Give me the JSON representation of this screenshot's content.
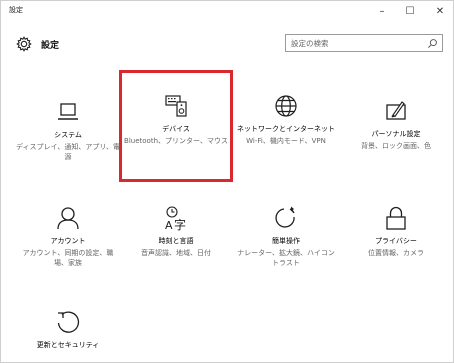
{
  "window": {
    "title": "設定",
    "controls": {
      "minimize": "–",
      "maximize": "☐",
      "close": "✕"
    }
  },
  "header": {
    "title": "設定",
    "search_placeholder": "設定の検索"
  },
  "tiles": [
    {
      "label": "システム",
      "desc": "ディスプレイ、通知、アプリ、電源"
    },
    {
      "label": "デバイス",
      "desc": "Bluetooth、プリンター、マウス"
    },
    {
      "label": "ネットワークとインターネット",
      "desc": "Wi-Fi、機内モード、VPN"
    },
    {
      "label": "パーソナル設定",
      "desc": "背景、ロック画面、色"
    },
    {
      "label": "アカウント",
      "desc": "アカウント、同期の設定、職場、家族"
    },
    {
      "label": "時刻と言語",
      "desc": "音声認識、地域、日付"
    },
    {
      "label": "簡単操作",
      "desc": "ナレーター、拡大鏡、ハイコントラスト"
    },
    {
      "label": "プライバシー",
      "desc": "位置情報、カメラ"
    },
    {
      "label": "更新とセキュリティ",
      "desc": ""
    }
  ],
  "colors": {
    "highlight": "#d9282e",
    "icon": "#1f1f1f"
  }
}
